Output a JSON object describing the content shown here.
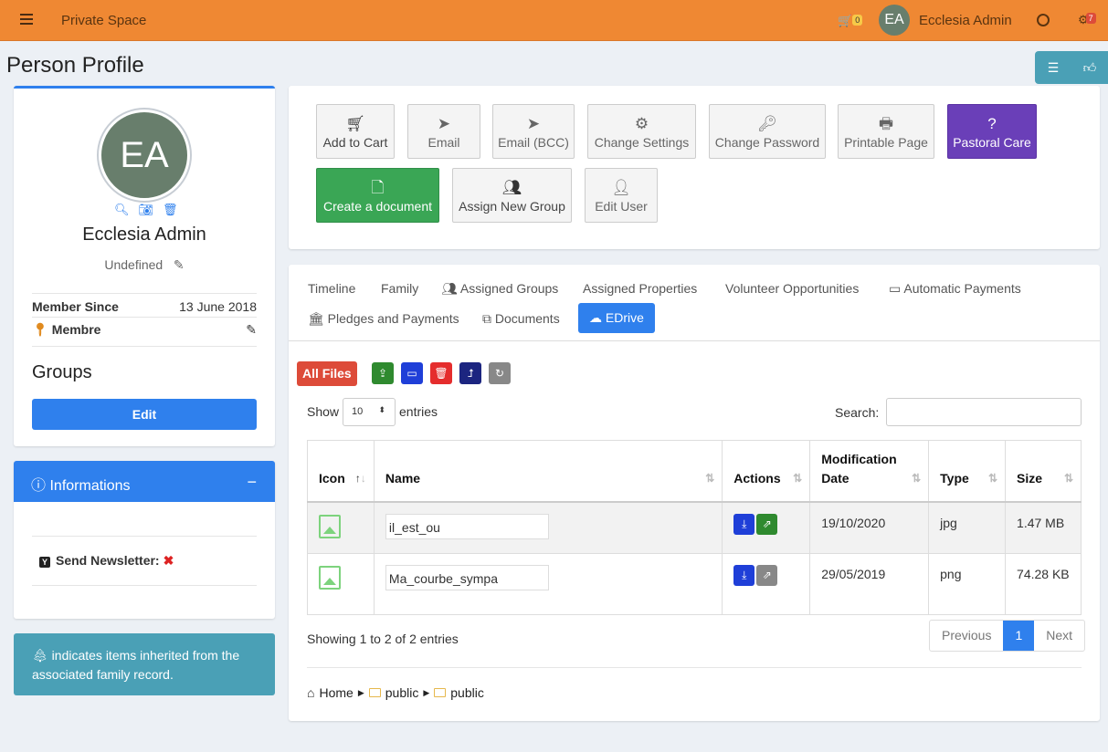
{
  "topbar": {
    "brand": "Private Space",
    "cart_count": "0",
    "user_initials": "EA",
    "user_name": "Ecclesia Admin",
    "notif_count": "7",
    "accent_color": "#ef8833"
  },
  "page": {
    "title": "Person Profile"
  },
  "profile": {
    "initials": "EA",
    "name": "Ecclesia Admin",
    "classification": "Undefined",
    "member_since_label": "Member Since",
    "member_since_value": "13 June 2018",
    "role": "Membre",
    "groups_title": "Groups",
    "edit_label": "Edit"
  },
  "info": {
    "title": "Informations",
    "newsletter_label": "Send Newsletter:",
    "newsletter_badge": "Y"
  },
  "callout": {
    "text": "indicates items inherited from the associated family record."
  },
  "actions": {
    "add_to_cart": "Add to Cart",
    "email": "Email",
    "email_bcc": "Email (BCC)",
    "change_settings": "Change Settings",
    "change_password": "Change Password",
    "printable_page": "Printable Page",
    "pastoral_care": "Pastoral Care",
    "create_document": "Create a document",
    "assign_new_group": "Assign New Group",
    "edit_user": "Edit User"
  },
  "tabs": {
    "timeline": "Timeline",
    "family": "Family",
    "assigned_groups": "Assigned Groups",
    "assigned_properties": "Assigned Properties",
    "volunteer": "Volunteer Opportunities",
    "automatic_payments": "Automatic Payments",
    "pledges": "Pledges and Payments",
    "documents": "Documents",
    "edrive": "EDrive"
  },
  "edrive": {
    "all_files": "All Files",
    "show": "Show",
    "page_size": "10",
    "entries": "entries",
    "search_label": "Search:",
    "search_value": "",
    "columns": {
      "icon": "Icon",
      "name": "Name",
      "actions": "Actions",
      "modified": "Modification Date",
      "type": "Type",
      "size": "Size"
    },
    "rows": [
      {
        "name": "il_est_ou",
        "date": "19/10/2020",
        "type": "jpg",
        "size": "1.47 MB"
      },
      {
        "name": "Ma_courbe_sympa",
        "date": "29/05/2019",
        "type": "png",
        "size": "74.28 KB"
      }
    ],
    "summary": "Showing 1 to 2 of 2 entries",
    "previous": "Previous",
    "page": "1",
    "next": "Next",
    "breadcrumb": {
      "home": "Home",
      "folder1": "public",
      "folder2": "public"
    }
  }
}
